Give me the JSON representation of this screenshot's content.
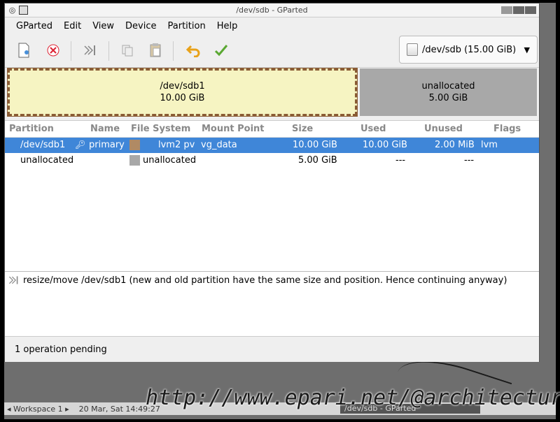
{
  "window": {
    "title": "/dev/sdb - GParted"
  },
  "menu": [
    "GParted",
    "Edit",
    "View",
    "Device",
    "Partition",
    "Help"
  ],
  "toolbar": {
    "icons": [
      "new-icon",
      "delete-icon",
      "resize-move-icon",
      "copy-icon",
      "paste-icon",
      "undo-icon",
      "apply-icon"
    ],
    "device_selector": "/dev/sdb (15.00 GiB)"
  },
  "partition_map": {
    "sdb1": {
      "name": "/dev/sdb1",
      "size": "10.00 GiB"
    },
    "unallocated": {
      "name": "unallocated",
      "size": "5.00 GiB"
    }
  },
  "table": {
    "headers": [
      "Partition",
      "Name",
      "File System",
      "Mount Point",
      "Size",
      "Used",
      "Unused",
      "Flags"
    ],
    "rows": [
      {
        "partition": "/dev/sdb1",
        "name": "primary",
        "filesystem": "lvm2 pv",
        "mount": "vg_data",
        "size": "10.00 GiB",
        "used": "10.00 GiB",
        "unused": "2.00 MiB",
        "flags": "lvm",
        "fs_color": "#b08a64",
        "selected": true
      },
      {
        "partition": "unallocated",
        "name": "",
        "filesystem": "unallocated",
        "mount": "",
        "size": "5.00 GiB",
        "used": "---",
        "unused": "---",
        "flags": "",
        "fs_color": "#a8a8a8",
        "selected": false
      }
    ]
  },
  "log": {
    "line": "resize/move /dev/sdb1 (new and old partition have the same size and position.  Hence continuing anyway)"
  },
  "status": {
    "text": "1 operation pending"
  },
  "panel": {
    "workspace": "◂ Workspace 1 ▸",
    "clock": "20 Mar, Sat 14:49:27",
    "task": "/dev/sdb - GParted"
  },
  "watermark": "http://www.epari.net/@architecture",
  "colors": {
    "selection": "#3f86d8",
    "partition_fill": "#f6f4c2",
    "partition_border": "#8a5c35",
    "unallocated": "#a8a8a8"
  }
}
